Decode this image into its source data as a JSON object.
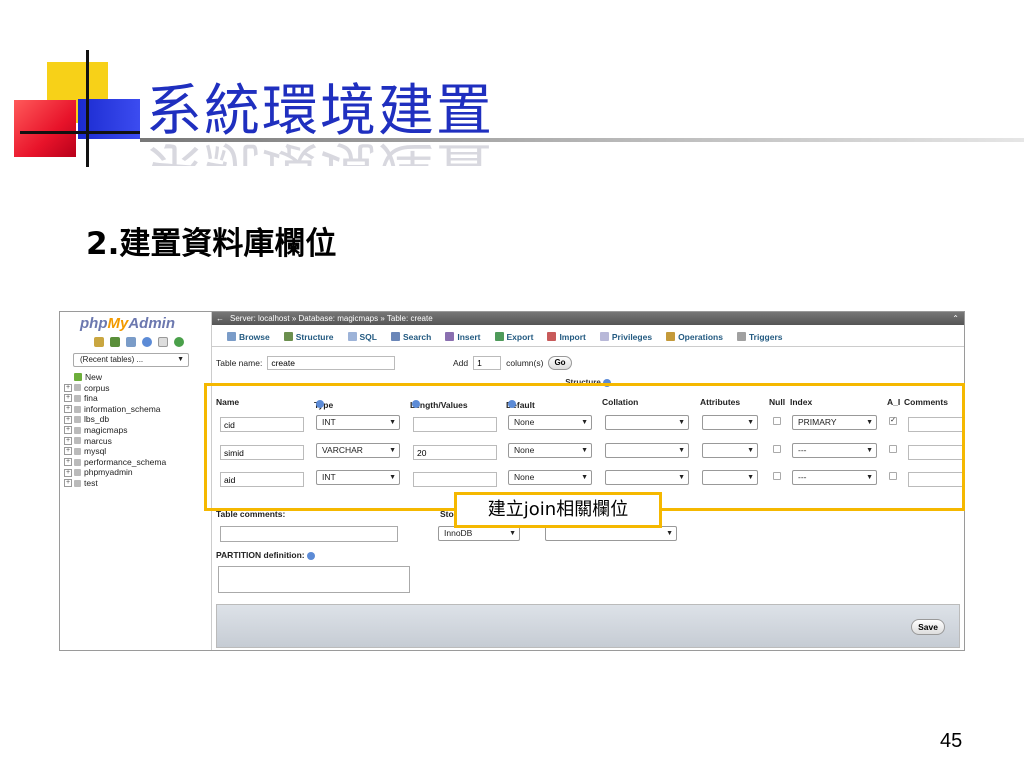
{
  "slide": {
    "title": "系統環境建置",
    "subtitle": "2.建置資料庫欄位",
    "page_number": "45",
    "callout": "建立join相關欄位",
    "accent_colors": {
      "title": "#1f2fbf",
      "highlight": "#f5b800",
      "yellow": "#f7d118",
      "red": "#e8132a",
      "blue": "#1b2bd0"
    }
  },
  "pma": {
    "logo": {
      "php": "php",
      "my": "My",
      "admin": "Admin"
    },
    "quick_icons": [
      "home-icon",
      "logout-icon",
      "query-window-icon",
      "docs-icon",
      "wiki-icon",
      "reload-icon"
    ],
    "recent_tables": "(Recent tables) ...",
    "new_label": "New",
    "databases": [
      "corpus",
      "fina",
      "information_schema",
      "lbs_db",
      "magicmaps",
      "marcus",
      "mysql",
      "performance_schema",
      "phpmyadmin",
      "test"
    ],
    "breadcrumb": {
      "server": "Server: localhost",
      "sep1": "»",
      "database": "Database: magicmaps",
      "sep2": "»",
      "table": "Table: create"
    },
    "tabs": [
      "Browse",
      "Structure",
      "SQL",
      "Search",
      "Insert",
      "Export",
      "Import",
      "Privileges",
      "Operations",
      "Triggers"
    ],
    "table_name_label": "Table name:",
    "table_name_value": "create",
    "add_label": "Add",
    "add_value": "1",
    "columns_label": "column(s)",
    "go_label": "Go",
    "structure_label": "Structure",
    "headers": {
      "name": "Name",
      "type": "Type",
      "length": "Length/Values",
      "default": "Default",
      "collation": "Collation",
      "attributes": "Attributes",
      "null": "Null",
      "index": "Index",
      "ai": "A_I",
      "comments": "Comments"
    },
    "fields": [
      {
        "name": "cid",
        "type": "INT",
        "length": "",
        "default": "None",
        "collation": "",
        "attributes": "",
        "null": false,
        "index": "PRIMARY",
        "ai": true
      },
      {
        "name": "simid",
        "type": "VARCHAR",
        "length": "20",
        "default": "None",
        "collation": "",
        "attributes": "",
        "null": false,
        "index": "---",
        "ai": false
      },
      {
        "name": "aid",
        "type": "INT",
        "length": "",
        "default": "None",
        "collation": "",
        "attributes": "",
        "null": false,
        "index": "---",
        "ai": false
      }
    ],
    "table_comments_label": "Table comments:",
    "storage_label": "Sto",
    "storage_value": "InnoDB",
    "partition_label": "PARTITION definition:",
    "save_label": "Save"
  }
}
